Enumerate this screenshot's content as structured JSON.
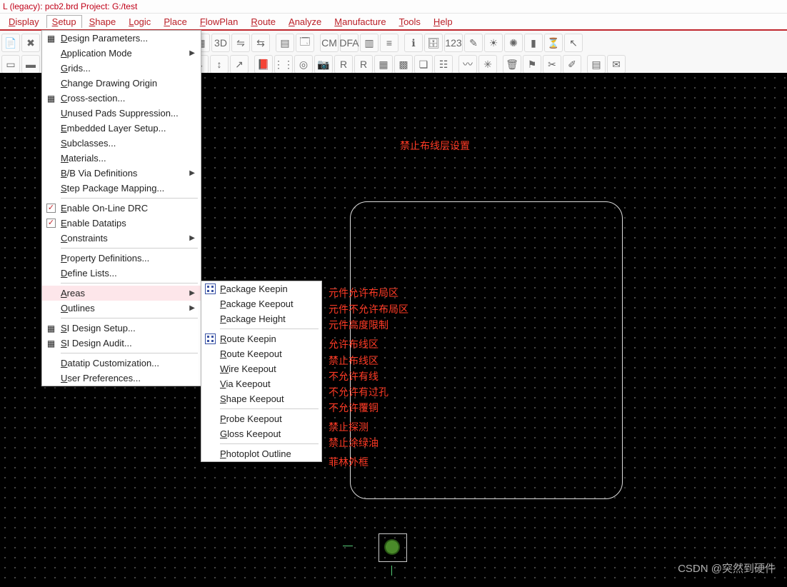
{
  "title": "L (legacy): pcb2.brd  Project: G:/test",
  "menubar": [
    "Display",
    "Setup",
    "Shape",
    "Logic",
    "Place",
    "FlowPlan",
    "Route",
    "Analyze",
    "Manufacture",
    "Tools",
    "Help"
  ],
  "menu_active_index": 1,
  "setup_menu": {
    "items": [
      {
        "label": "Design Parameters...",
        "icon": "grid"
      },
      {
        "label": "Application Mode",
        "arrow": true
      },
      {
        "label": "Grids..."
      },
      {
        "label": "Change Drawing Origin"
      },
      {
        "label": "Cross-section...",
        "icon": "layers"
      },
      {
        "label": "Unused Pads Suppression..."
      },
      {
        "label": "Embedded Layer Setup..."
      },
      {
        "label": "Subclasses..."
      },
      {
        "label": "Materials..."
      },
      {
        "label": "B/B Via Definitions",
        "arrow": true
      },
      {
        "label": "Step Package Mapping..."
      },
      {
        "sep": true
      },
      {
        "label": "Enable On-Line DRC",
        "check": true
      },
      {
        "label": "Enable Datatips",
        "check": true
      },
      {
        "label": "Constraints",
        "arrow": true
      },
      {
        "sep": true
      },
      {
        "label": "Property Definitions..."
      },
      {
        "label": "Define Lists..."
      },
      {
        "sep": true
      },
      {
        "label": "Areas",
        "arrow": true,
        "highlight": true
      },
      {
        "label": "Outlines",
        "arrow": true
      },
      {
        "sep": true
      },
      {
        "label": "SI Design Setup...",
        "icon": "gear"
      },
      {
        "label": "SI Design Audit...",
        "icon": "audit"
      },
      {
        "sep": true
      },
      {
        "label": "Datatip Customization..."
      },
      {
        "label": "User Preferences..."
      }
    ]
  },
  "areas_menu": {
    "items": [
      {
        "label": "Package Keepin",
        "icon": true
      },
      {
        "label": "Package Keepout"
      },
      {
        "label": "Package Height"
      },
      {
        "sep": true
      },
      {
        "label": "Route Keepin",
        "icon": true
      },
      {
        "label": "Route Keepout"
      },
      {
        "label": "Wire Keepout"
      },
      {
        "label": "Via Keepout"
      },
      {
        "label": "Shape Keepout"
      },
      {
        "sep": true
      },
      {
        "label": "Probe Keepout"
      },
      {
        "label": "Gloss Keepout"
      },
      {
        "sep": true
      },
      {
        "label": "Photoplot Outline"
      }
    ]
  },
  "annotations": {
    "header": "禁止布线层设置",
    "rows": [
      "元件允许布局区",
      "元件不允许布局区",
      "元件高度限制",
      "允许布线区",
      "禁止布线区",
      "不允许有线",
      "不允许有过孔",
      "不允许覆铜",
      "禁止探测",
      "禁止涂绿油",
      "菲林外框"
    ]
  },
  "watermark": "CSDN @突然到硬件",
  "toolbar_row1": [
    "file",
    "close",
    "",
    "",
    "",
    "",
    "",
    "",
    "",
    "zoom-in",
    "zoom-out",
    "zoom-fit",
    "zoom-area",
    "zoom-prev",
    "refresh",
    "grid",
    "3d",
    "flip",
    "swap",
    "",
    "tile",
    "win",
    "",
    "cm",
    "dfa",
    "sheet",
    "rule",
    "",
    "info",
    "db",
    "num",
    "wand",
    "sun",
    "rays",
    "bars",
    "timer",
    "cursor"
  ],
  "toolbar_row2": [
    "rect1",
    "rect2",
    "rect3",
    "odb",
    "",
    "sq1",
    "sq2",
    "sq3",
    "del",
    "",
    "comp",
    "dim1",
    "dim2",
    "dim3",
    "",
    "book",
    "pins",
    "via",
    "cam",
    "r1",
    "r2",
    "net",
    "mesh",
    "conn",
    "tree",
    "",
    "wave",
    "star",
    "",
    "trash",
    "flag",
    "tool1",
    "tool2",
    "",
    "layer",
    "mail"
  ]
}
